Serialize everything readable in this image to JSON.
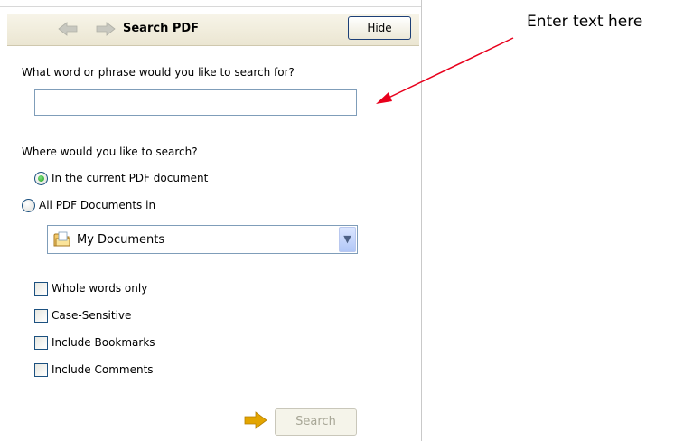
{
  "panel": {
    "title": "Search PDF",
    "hide_label": "Hide"
  },
  "search": {
    "question": "What word or phrase would you like to search for?",
    "input_value": "",
    "input_placeholder": ""
  },
  "scope": {
    "question": "Where would you like to search?",
    "options": [
      {
        "label": "In the current PDF document",
        "selected": true
      },
      {
        "label": "All PDF Documents in",
        "selected": false
      }
    ],
    "location": "My Documents"
  },
  "options": [
    {
      "label": "Whole words only",
      "checked": false
    },
    {
      "label": "Case-Sensitive",
      "checked": false
    },
    {
      "label": "Include Bookmarks",
      "checked": false
    },
    {
      "label": "Include Comments",
      "checked": false
    }
  ],
  "actions": {
    "search_label": "Search"
  },
  "annotation": {
    "text": "Enter text here",
    "color": "#e8001c"
  },
  "icons": {
    "back": "back-arrow-icon",
    "forward": "forward-arrow-icon",
    "folder": "folder-icon",
    "dropdown": "chevron-down-icon",
    "go": "go-arrow-icon"
  },
  "colors": {
    "titlebar": "#ebe6d2",
    "input_border": "#7f9db9",
    "radio_selected": "#21a121",
    "go_arrow": "#e3a500"
  }
}
